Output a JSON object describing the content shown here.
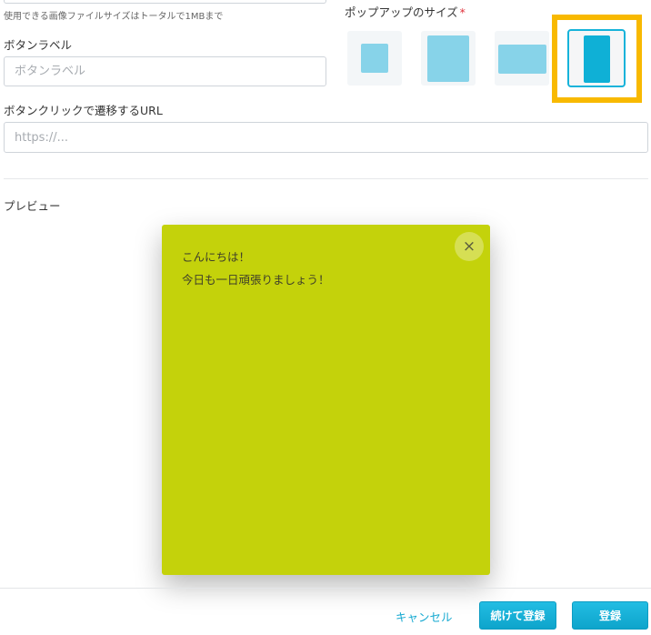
{
  "form": {
    "upload_hint": "使用できる画像ファイルサイズはトータルで1MBまで",
    "button_label": {
      "label": "ボタンラベル",
      "value": "",
      "placeholder": "ボタンラベル"
    },
    "button_url": {
      "label": "ボタンクリックで遷移するURL",
      "value": "",
      "placeholder": "https://..."
    },
    "popup_size": {
      "label": "ポップアップのサイズ",
      "required_mark": "*",
      "options": [
        "small-square",
        "large-square",
        "wide",
        "tall"
      ],
      "selected": "tall"
    }
  },
  "preview": {
    "label": "プレビュー",
    "popup": {
      "lines": [
        "こんにちは！",
        "今日も一日頑張りましょう！"
      ],
      "close_icon": "×",
      "background_color": "#c4d20b"
    }
  },
  "footer": {
    "cancel_label": "キャンセル",
    "continue_label": "続けて登録",
    "submit_label": "登録"
  },
  "colors": {
    "accent": "#16b3da",
    "highlight": "#f8b900"
  }
}
